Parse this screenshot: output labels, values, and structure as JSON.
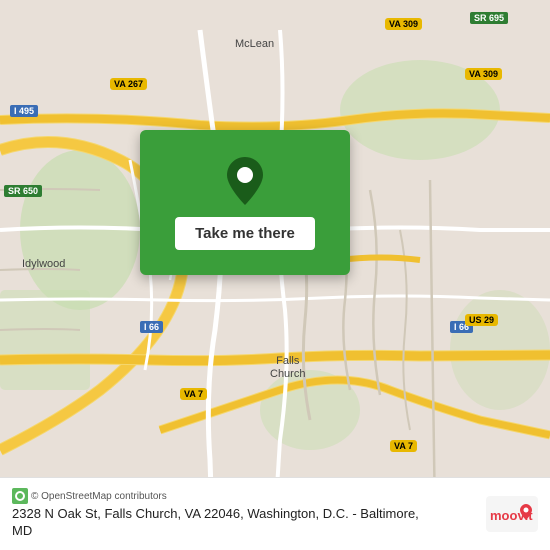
{
  "map": {
    "center_address": "2328 N Oak St, Falls Church, VA 22046, Washington, D.C. - Baltimore, MD",
    "region": "Falls Church, VA area",
    "osm_credit": "© OpenStreetMap contributors"
  },
  "location_card": {
    "button_label": "Take me there"
  },
  "labels": {
    "mclean": "McLean",
    "idylwood": "Idylwood",
    "falls_church": "Falls\nChurch"
  },
  "highway_badges": [
    {
      "id": "i495",
      "label": "I 495",
      "color": "blue"
    },
    {
      "id": "i66_1",
      "label": "I 66",
      "color": "blue"
    },
    {
      "id": "i66_2",
      "label": "I 66",
      "color": "blue"
    },
    {
      "id": "sr695",
      "label": "SR 695",
      "color": "green"
    },
    {
      "id": "sr650",
      "label": "SR 650",
      "color": "green"
    },
    {
      "id": "va267",
      "label": "VA 267",
      "color": "yellow"
    },
    {
      "id": "va309_1",
      "label": "VA 309",
      "color": "yellow"
    },
    {
      "id": "va309_2",
      "label": "VA 309",
      "color": "yellow"
    },
    {
      "id": "va7",
      "label": "VA 7",
      "color": "yellow"
    },
    {
      "id": "va7b",
      "label": "VA 7",
      "color": "yellow"
    },
    {
      "id": "us29",
      "label": "US 29",
      "color": "yellow"
    }
  ],
  "branding": {
    "moovit_text": "moovit"
  }
}
